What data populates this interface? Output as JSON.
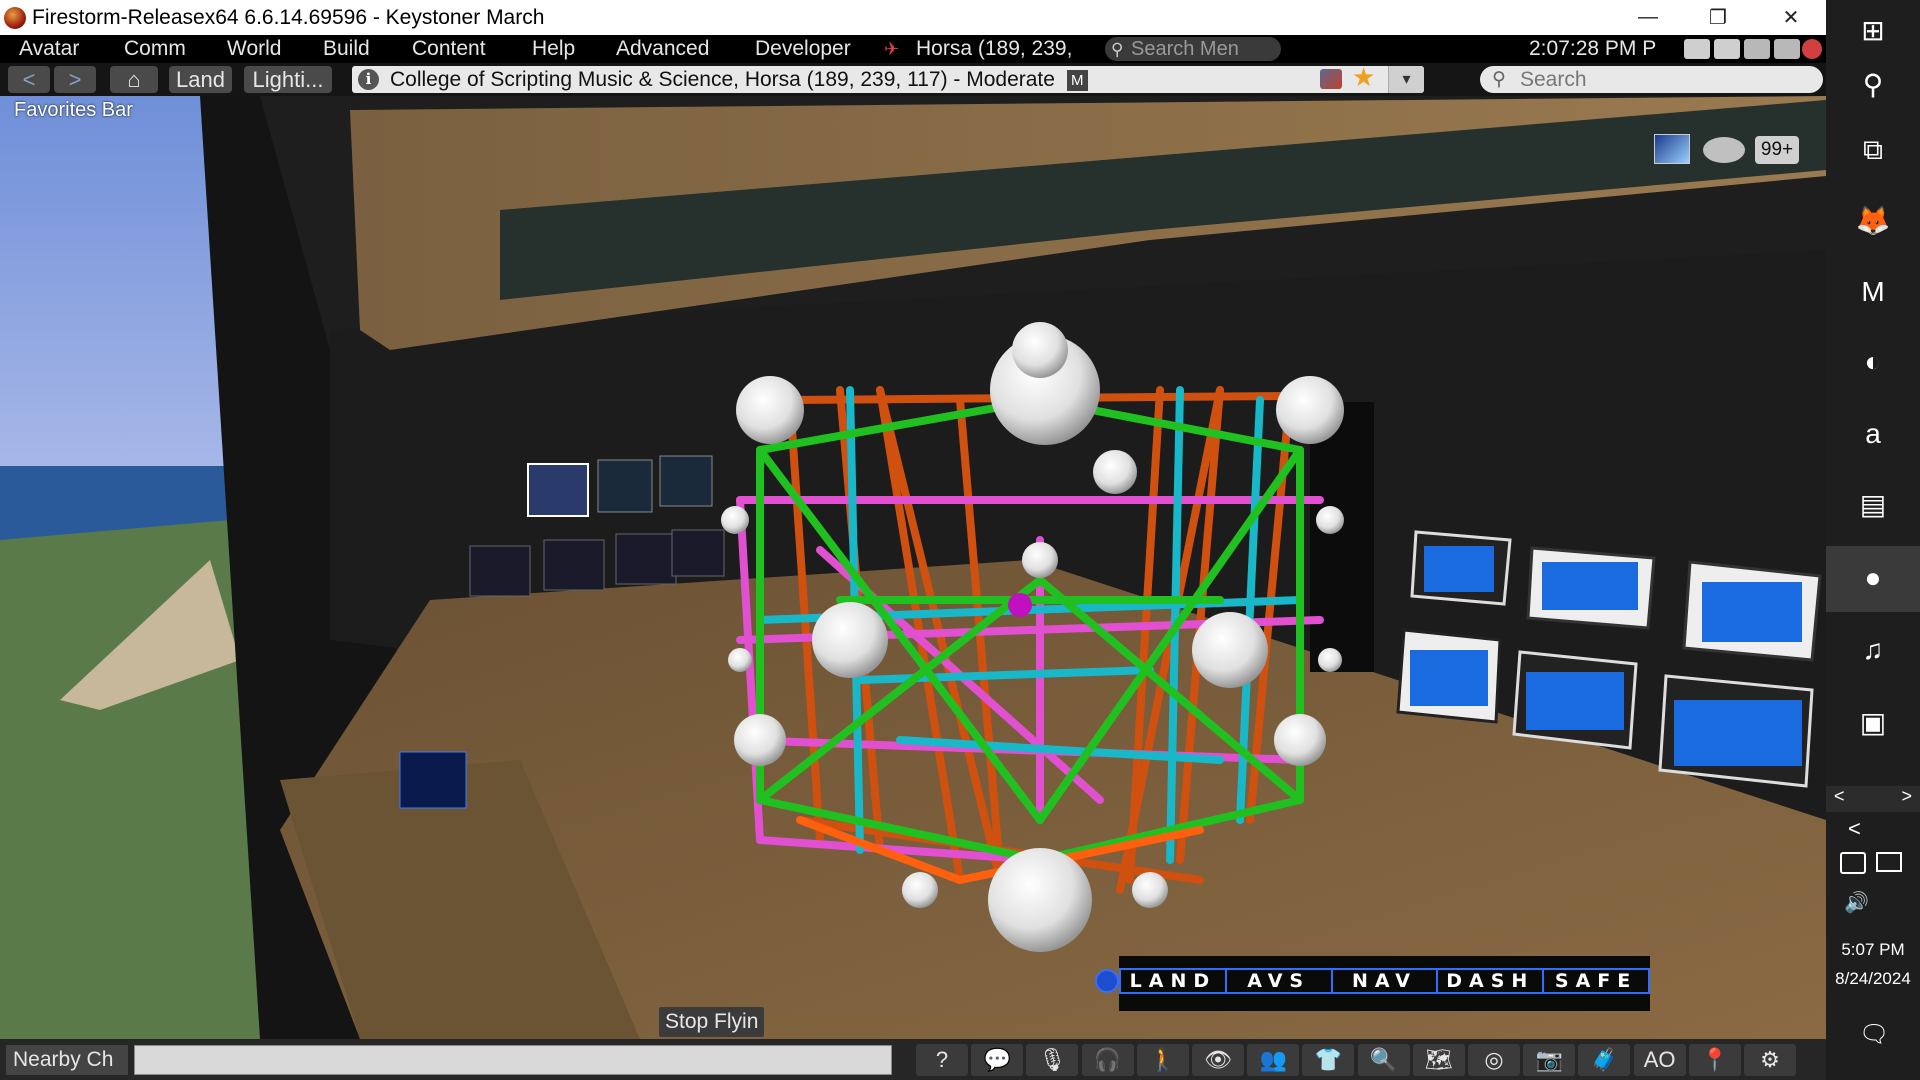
{
  "window": {
    "title": "Firestorm-Releasex64 6.6.14.69596 - Keystoner March",
    "minimize": "—",
    "restore": "❐",
    "close": "✕"
  },
  "menubar": {
    "items": [
      "Avatar",
      "Comm",
      "World",
      "Build",
      "Content",
      "Help",
      "Advanced",
      "Developer"
    ],
    "location": "Horsa (189, 239,",
    "search_placeholder": "Search Men",
    "clock": "2:07:28 PM P"
  },
  "navbar": {
    "back": "<",
    "forward": ">",
    "home": "⌂",
    "land": "Land",
    "lighting": "Lighti...",
    "address": "College of Scripting Music & Science, Horsa (189, 239, 117) - Moderate",
    "info": "i",
    "rating": "M",
    "star": "★",
    "dropdown": "▾",
    "search_placeholder": "Search",
    "search_glyph": "🔍"
  },
  "favorites": {
    "label": "Favorites Bar"
  },
  "hud": {
    "segments": [
      "LAND",
      "AVS",
      "NAV",
      "DASH",
      "SAFE"
    ],
    "notification_count": "99+"
  },
  "stop_flying": "Stop Flyin",
  "bottombar": {
    "nearby_chat": "Nearby Ch",
    "toolbar_buttons": [
      {
        "name": "help-icon",
        "glyph": "?"
      },
      {
        "name": "chat-icon",
        "glyph": "💬"
      },
      {
        "name": "voice-icon",
        "glyph": "🎙"
      },
      {
        "name": "headset-icon",
        "glyph": "🎧"
      },
      {
        "name": "walk-icon",
        "glyph": "🚶"
      },
      {
        "name": "view-icon",
        "glyph": "👁"
      },
      {
        "name": "people-icon",
        "glyph": "👥"
      },
      {
        "name": "appearance-icon",
        "glyph": "👕"
      },
      {
        "name": "search-icon",
        "glyph": "🔍"
      },
      {
        "name": "map-icon",
        "glyph": "🗺"
      },
      {
        "name": "radar-icon",
        "glyph": "◎"
      },
      {
        "name": "snapshot-icon",
        "glyph": "📷"
      },
      {
        "name": "inventory-icon",
        "glyph": "🧳"
      },
      {
        "name": "ao-icon",
        "glyph": "AO"
      },
      {
        "name": "minimap-icon",
        "glyph": "📍"
      },
      {
        "name": "settings-icon",
        "glyph": "⚙"
      }
    ]
  },
  "taskbar": {
    "time": "5:07 PM",
    "date": "8/24/2024",
    "icons": [
      {
        "name": "windows-start-icon",
        "glyph": "⊞"
      },
      {
        "name": "search-icon",
        "glyph": "⚲"
      },
      {
        "name": "task-view-icon",
        "glyph": "⧉"
      },
      {
        "name": "firefox-icon",
        "glyph": "🦊"
      },
      {
        "name": "m-app-icon",
        "glyph": "M"
      },
      {
        "name": "green-app-icon",
        "glyph": "◐"
      },
      {
        "name": "red-a-app-icon",
        "glyph": "a"
      },
      {
        "name": "notes-app-icon",
        "glyph": "▤"
      },
      {
        "name": "firestorm-icon",
        "glyph": "●"
      },
      {
        "name": "audio-app-icon",
        "glyph": "♫"
      },
      {
        "name": "monitor-app-icon",
        "glyph": "▣"
      }
    ],
    "chevron": "<",
    "scroll_left": "<",
    "scroll_right": ">",
    "notification": "🗨"
  }
}
